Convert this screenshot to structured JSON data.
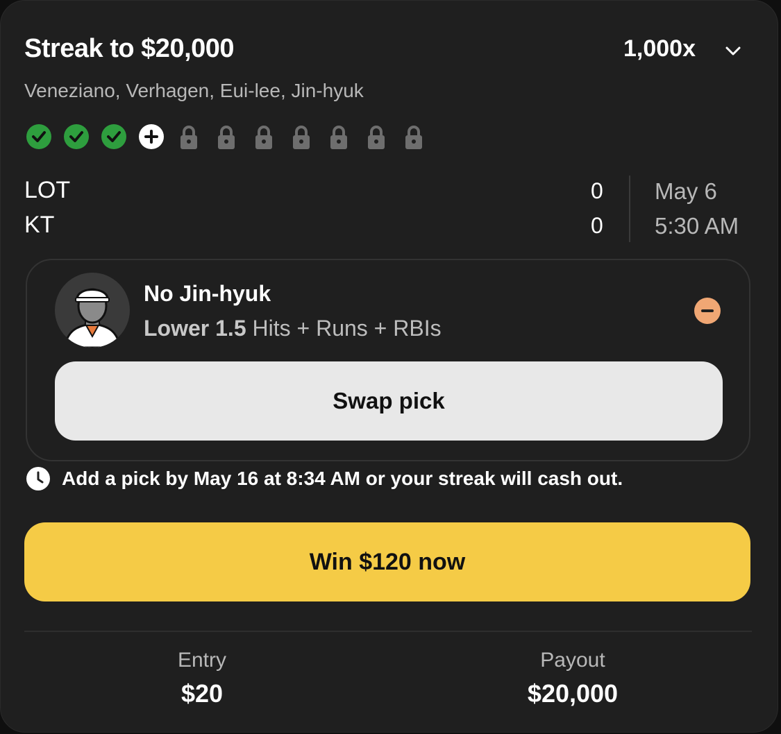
{
  "header": {
    "title": "Streak to $20,000",
    "multiplier": "1,000x"
  },
  "players_line": "Veneziano, Verhagen, Eui-lee, Jin-hyuk",
  "progress": {
    "completed": 3,
    "current": 1,
    "locked": 7,
    "colors": {
      "completed": "#2e9e3e",
      "current": "#ffffff",
      "locked": "#6e6e6e"
    }
  },
  "game": {
    "teams": [
      {
        "name": "LOT",
        "score": "0"
      },
      {
        "name": "KT",
        "score": "0"
      }
    ],
    "date": "May 6",
    "time": "5:30 AM"
  },
  "pick": {
    "player": "No Jin-hyuk",
    "direction": "Lower 1.5",
    "stat": "Hits + Runs + RBIs",
    "swap_label": "Swap pick",
    "remove_color": "#f0a774"
  },
  "notice": "Add a pick by May 16 at 8:34 AM or your streak will cash out.",
  "cashout": {
    "label": "Win $120 now",
    "color": "#f5cb46"
  },
  "summary": {
    "entry_label": "Entry",
    "entry_value": "$20",
    "payout_label": "Payout",
    "payout_value": "$20,000"
  }
}
